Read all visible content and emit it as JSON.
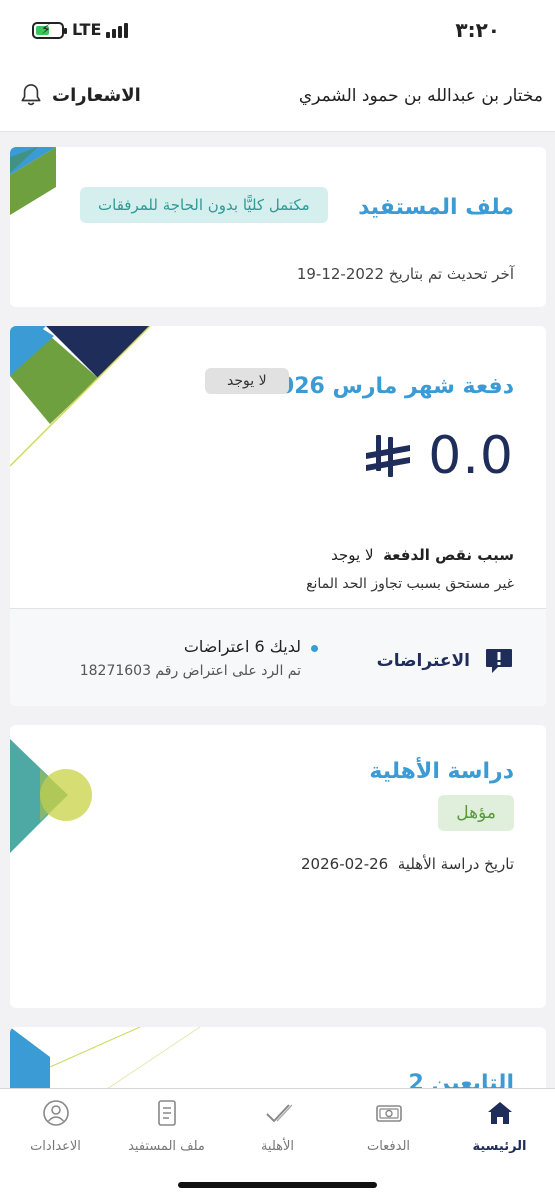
{
  "status_bar": {
    "time": "٣:٢٠",
    "network": "LTE",
    "battery_level": 0.55
  },
  "header": {
    "user_name": "مختار بن عبدالله بن حمود الشمري",
    "notifications_label": "الاشعارات"
  },
  "profile_card": {
    "title": "ملف المستفيد",
    "status_badge": "مكتمل كليًّا بدون الحاجة للمرفقات",
    "last_update": "آخر تحديث تم بتاريخ 2022-12-19"
  },
  "payment_card": {
    "title": "دفعة شهر مارس 2026",
    "status_pill": "لا يوجد",
    "amount": "0.0",
    "reason_label": "سبب نقص الدفعة",
    "reason_value": "لا يوجد",
    "reason_detail": "غير مستحق بسبب تجاوز الحد المانع",
    "objections": {
      "label": "الاعتراضات",
      "count_text": "لديك 6 اعتراضات",
      "detail_text": "تم الرد على اعتراض رقم 18271603"
    }
  },
  "eligibility_card": {
    "title": "دراسة الأهلية",
    "status_badge": "مؤهل",
    "date_label": "تاريخ دراسة الأهلية",
    "date_value": "2026-02-26"
  },
  "partial_card": {
    "title": "التابعين 2"
  },
  "bottom_nav": {
    "items": [
      {
        "label": "الرئيسية",
        "icon": "home-icon",
        "active": true
      },
      {
        "label": "الدفعات",
        "icon": "money-icon",
        "active": false
      },
      {
        "label": "الأهلية",
        "icon": "checkmark-icon",
        "active": false
      },
      {
        "label": "ملف المستفيد",
        "icon": "document-icon",
        "active": false
      },
      {
        "label": "الاعدادات",
        "icon": "person-icon",
        "active": false
      }
    ]
  },
  "colors": {
    "accent_blue": "#3a9bd5",
    "navy": "#1f2d5a",
    "green": "#6fa03f",
    "teal": "#4ea9a5",
    "lime": "#cfd85a"
  }
}
